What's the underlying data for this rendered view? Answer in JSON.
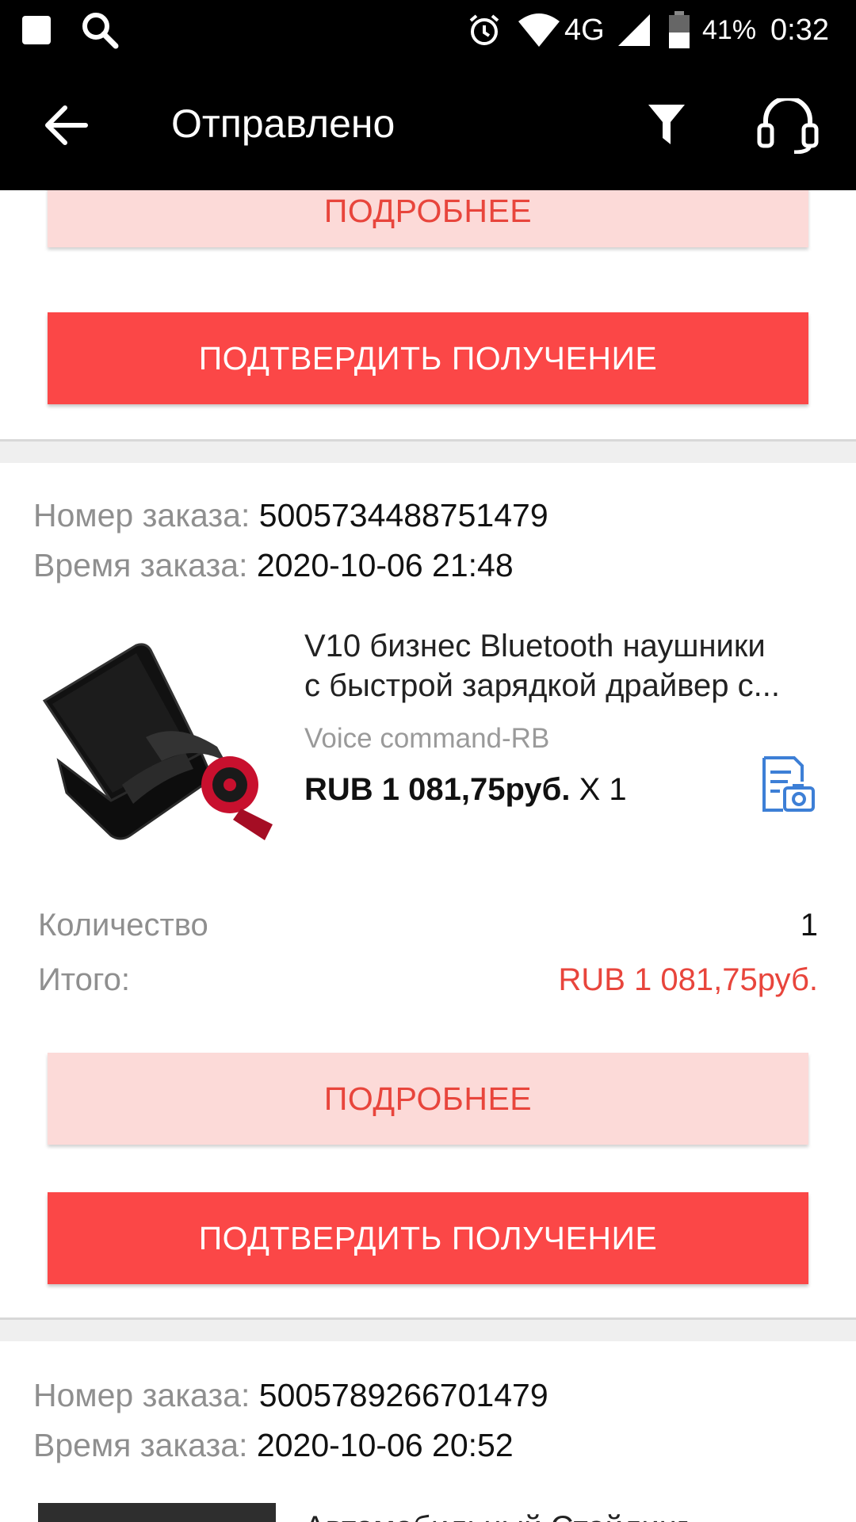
{
  "status_bar": {
    "battery_percent": "41%",
    "network": "4G",
    "time": "0:32",
    "icons": [
      "notification-square-icon",
      "search-icon",
      "alarm-icon",
      "wifi-icon",
      "signal-icon",
      "battery-icon"
    ]
  },
  "toolbar": {
    "title": "Отправлено",
    "icons": [
      "back-arrow-icon",
      "filter-icon",
      "support-headset-icon"
    ]
  },
  "buttons": {
    "details": "ПОДРОБНЕЕ",
    "confirm": "ПОДТВЕРДИТЬ ПОЛУЧЕНИЕ"
  },
  "labels": {
    "order_number": "Номер заказа:",
    "order_time": "Время заказа:",
    "quantity": "Количество",
    "total": "Итого:"
  },
  "orders": [
    {
      "number": "5005734488751479",
      "time": "2020-10-06 21:48",
      "product": {
        "title_line1": "V10 бизнес Bluetooth наушники",
        "title_line2": "с быстрой зарядкой драйвер с...",
        "variant": "Voice command-RB",
        "price": "RUB 1 081,75руб.",
        "multiplier": "X 1"
      },
      "quantity": "1",
      "total": "RUB 1 081,75руб."
    },
    {
      "number": "5005789266701479",
      "time": "2020-10-06 20:52",
      "product": {
        "title_line1": "Автомобильный Стайлинг"
      }
    }
  ],
  "colors": {
    "accent_red": "#fb4747",
    "light_button_bg": "#fcdad8",
    "light_button_text": "#e8453c",
    "price_red": "#e8453c",
    "icon_blue": "#3d7fd6"
  }
}
